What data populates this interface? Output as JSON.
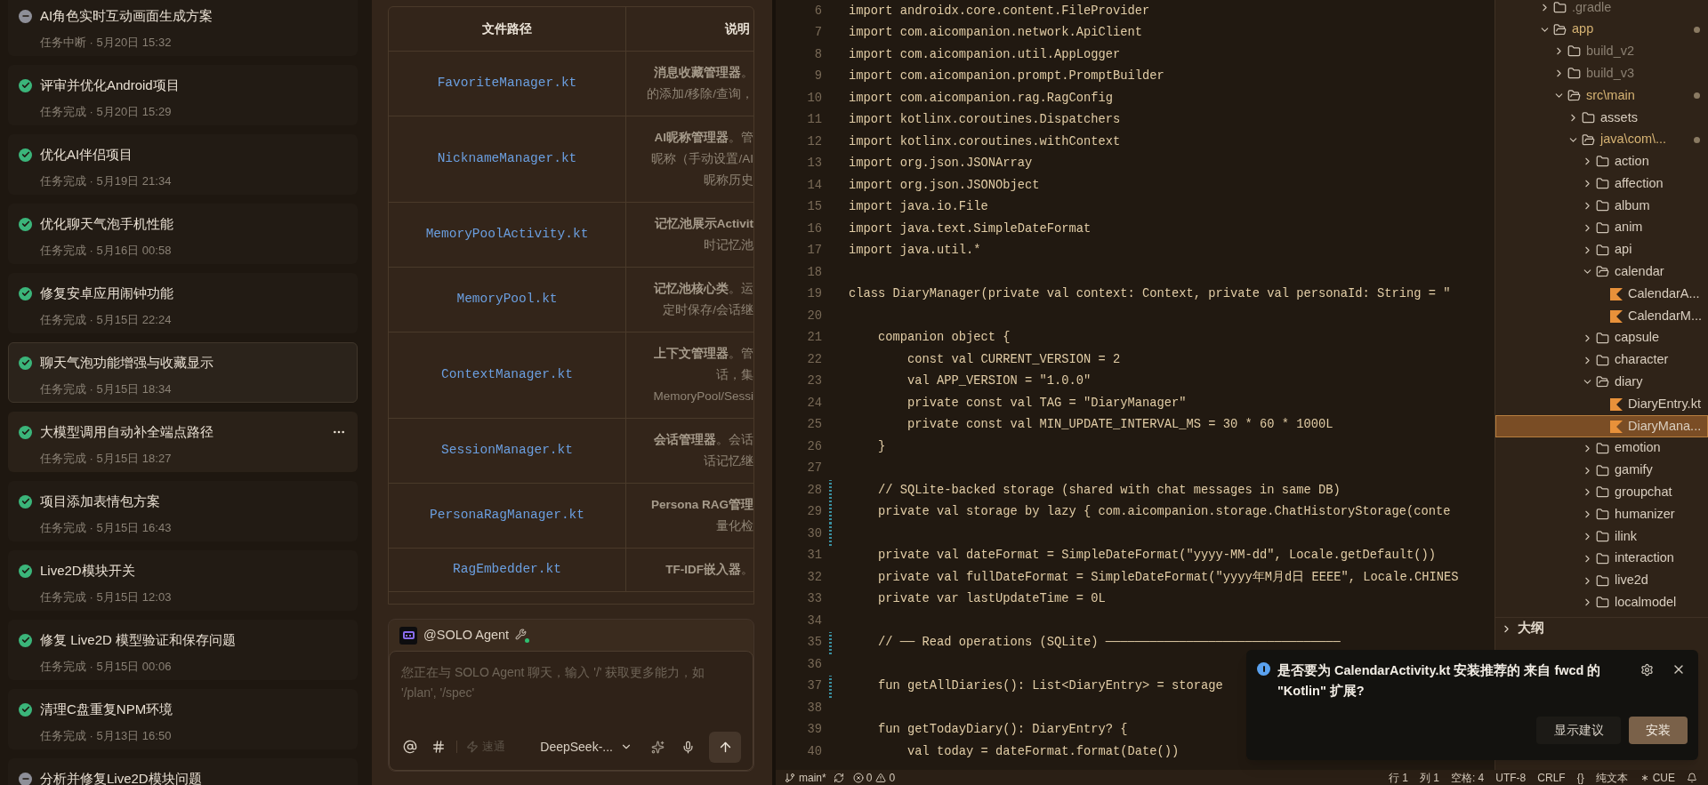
{
  "task_list": {
    "items": [
      {
        "title": "AI角色实时互动画面生成方案",
        "subtitle": "任务中断 · 5月20日 15:32",
        "completed": false,
        "selected": false,
        "hovered": false
      },
      {
        "title": "评审并优化Android项目",
        "subtitle": "任务完成 · 5月20日 15:29",
        "completed": true,
        "selected": false,
        "hovered": false
      },
      {
        "title": "优化AI伴侣项目",
        "subtitle": "任务完成 · 5月19日 21:34",
        "completed": true,
        "selected": false,
        "hovered": false
      },
      {
        "title": "优化聊天气泡手机性能",
        "subtitle": "任务完成 · 5月16日 00:58",
        "completed": true,
        "selected": false,
        "hovered": false
      },
      {
        "title": "修复安卓应用闹钟功能",
        "subtitle": "任务完成 · 5月15日 22:24",
        "completed": true,
        "selected": false,
        "hovered": false
      },
      {
        "title": "聊天气泡功能增强与收藏显示",
        "subtitle": "任务完成 · 5月15日 18:34",
        "completed": true,
        "selected": true,
        "hovered": false
      },
      {
        "title": "大模型调用自动补全端点路径",
        "subtitle": "任务完成 · 5月15日 18:27",
        "completed": true,
        "selected": false,
        "hovered": true
      },
      {
        "title": "项目添加表情包方案",
        "subtitle": "任务完成 · 5月15日 16:43",
        "completed": true,
        "selected": false,
        "hovered": false
      },
      {
        "title": "Live2D模块开关",
        "subtitle": "任务完成 · 5月15日 12:03",
        "completed": true,
        "selected": false,
        "hovered": false
      },
      {
        "title": "修复 Live2D 模型验证和保存问题",
        "subtitle": "任务完成 · 5月15日 00:06",
        "completed": true,
        "selected": false,
        "hovered": false
      },
      {
        "title": "清理C盘重复NPM环境",
        "subtitle": "任务完成 · 5月13日 16:50",
        "completed": true,
        "selected": false,
        "hovered": false
      },
      {
        "title": "分析并修复Live2D模块问题",
        "completed": false,
        "selected": false,
        "hovered": false
      }
    ]
  },
  "doc_table": {
    "columns": [
      "文件路径",
      "说明"
    ],
    "rows": [
      {
        "file": "FavoriteManager.kt",
        "description": [
          "**消息收藏管理器**。",
          "的添加/移除/查询，"
        ]
      },
      {
        "file": "NicknameManager.kt",
        "description": [
          "**AI昵称管理器**。管",
          "昵称（手动设置/AI",
          "昵称历史"
        ]
      },
      {
        "file": "MemoryPoolActivity.kt",
        "description": [
          "**记忆池展示Activit**",
          "时记忆池"
        ]
      },
      {
        "file": "MemoryPool.kt",
        "description": [
          "**记忆池核心类**。运",
          "定时保存/会话继"
        ]
      },
      {
        "file": "ContextManager.kt",
        "description": [
          "**上下文管理器**。管",
          "话，集",
          "MemoryPool/Sessi"
        ]
      },
      {
        "file": "SessionManager.kt",
        "description": [
          "**会话管理器**。会话",
          "话记忆继"
        ]
      },
      {
        "file": "PersonaRagManager.kt",
        "description": [
          "**Persona RAG管理**",
          "量化检"
        ]
      },
      {
        "file": "RagEmbedder.kt",
        "description": [
          "**TF-IDF嵌入器**。"
        ]
      }
    ]
  },
  "chat": {
    "agent": "@SOLO Agent",
    "online": true,
    "placeholder": "您正在与 SOLO Agent 聊天，输入 '/' 获取更多能力，如 '/plan', '/spec'",
    "mode": {
      "label": "速通",
      "disabled": true
    },
    "model": "DeepSeek-..."
  },
  "editor": {
    "lines": [
      {
        "n": "6",
        "text": "import androidx.core.content.FileProvider",
        "changed": false
      },
      {
        "n": "7",
        "text": "import com.aicompanion.network.ApiClient",
        "changed": false
      },
      {
        "n": "8",
        "text": "import com.aicompanion.util.AppLogger",
        "changed": false
      },
      {
        "n": "9",
        "text": "import com.aicompanion.prompt.PromptBuilder",
        "changed": false
      },
      {
        "n": "10",
        "text": "import com.aicompanion.rag.RagConfig",
        "changed": false
      },
      {
        "n": "11",
        "text": "import kotlinx.coroutines.Dispatchers",
        "changed": false
      },
      {
        "n": "12",
        "text": "import kotlinx.coroutines.withContext",
        "changed": false
      },
      {
        "n": "13",
        "text": "import org.json.JSONArray",
        "changed": false
      },
      {
        "n": "14",
        "text": "import org.json.JSONObject",
        "changed": false
      },
      {
        "n": "15",
        "text": "import java.io.File",
        "changed": false
      },
      {
        "n": "16",
        "text": "import java.text.SimpleDateFormat",
        "changed": false
      },
      {
        "n": "17",
        "text": "import java.util.*",
        "changed": false
      },
      {
        "n": "18",
        "changed": false
      },
      {
        "n": "19",
        "text": "class DiaryManager(private val context: Context, private val personaId: String = \"",
        "changed": false
      },
      {
        "n": "20",
        "changed": false
      },
      {
        "n": "21",
        "text": "    companion object {",
        "changed": false
      },
      {
        "n": "22",
        "text": "        const val CURRENT_VERSION = 2",
        "changed": false
      },
      {
        "n": "23",
        "text": "        val APP_VERSION = \"1.0.0\"",
        "changed": false
      },
      {
        "n": "24",
        "text": "        private const val TAG = \"DiaryManager\"",
        "changed": false
      },
      {
        "n": "25",
        "text": "        private const val MIN_UPDATE_INTERVAL_MS = 30 * 60 * 1000L",
        "changed": false
      },
      {
        "n": "26",
        "text": "    }",
        "changed": false
      },
      {
        "n": "27",
        "changed": false
      },
      {
        "n": "28",
        "text": "    // SQLite-backed storage (shared with chat messages in same DB)",
        "changed": true
      },
      {
        "n": "29",
        "text": "    private val storage by lazy { com.aicompanion.storage.ChatHistoryStorage(conte",
        "changed": true
      },
      {
        "n": "30",
        "changed": true
      },
      {
        "n": "31",
        "text": "    private val dateFormat = SimpleDateFormat(\"yyyy-MM-dd\", Locale.getDefault())",
        "changed": false
      },
      {
        "n": "32",
        "text": "    private val fullDateFormat = SimpleDateFormat(\"yyyy年M月d日 EEEE\", Locale.CHINES",
        "changed": false
      },
      {
        "n": "33",
        "text": "    private var lastUpdateTime = 0L",
        "changed": false
      },
      {
        "n": "34",
        "changed": false
      },
      {
        "n": "35",
        "text": "    // ── Read operations (SQLite) ────────────────────────────────",
        "changed": true
      },
      {
        "n": "36",
        "changed": false
      },
      {
        "n": "37",
        "text": "    fun getAllDiaries(): List<DiaryEntry> = storage",
        "changed": true
      },
      {
        "n": "38",
        "changed": false
      },
      {
        "n": "39",
        "text": "    fun getTodayDiary(): DiaryEntry? {",
        "changed": false
      },
      {
        "n": "40",
        "text": "        val today = dateFormat.format(Date())",
        "changed": false
      }
    ]
  },
  "explorer": {
    "tree": [
      {
        "name": ".gradle",
        "kind": "folder",
        "expanded": false,
        "ignored": true,
        "modified": false,
        "selected": false
      },
      {
        "name": "app",
        "kind": "folder",
        "expanded": true,
        "ignored": false,
        "modified": true,
        "selected": false,
        "children": [
          {
            "name": "build_v2",
            "kind": "folder",
            "expanded": false,
            "ignored": true,
            "modified": false,
            "selected": false
          },
          {
            "name": "build_v3",
            "kind": "folder",
            "expanded": false,
            "ignored": true,
            "modified": false,
            "selected": false
          },
          {
            "name": "src\\main",
            "kind": "folder",
            "expanded": true,
            "ignored": false,
            "modified": true,
            "selected": false,
            "children": [
              {
                "name": "assets",
                "kind": "folder",
                "expanded": false,
                "ignored": false,
                "modified": false,
                "selected": false
              },
              {
                "name": "java\\com\\...",
                "kind": "folder",
                "expanded": true,
                "ignored": false,
                "modified": true,
                "selected": false,
                "children": [
                  {
                    "name": "action",
                    "kind": "folder",
                    "expanded": false,
                    "ignored": false,
                    "modified": false,
                    "selected": false
                  },
                  {
                    "name": "affection",
                    "kind": "folder",
                    "expanded": false,
                    "ignored": false,
                    "modified": false,
                    "selected": false
                  },
                  {
                    "name": "album",
                    "kind": "folder",
                    "expanded": false,
                    "ignored": false,
                    "modified": false,
                    "selected": false
                  },
                  {
                    "name": "anim",
                    "kind": "folder",
                    "expanded": false,
                    "ignored": false,
                    "modified": false,
                    "selected": false
                  },
                  {
                    "name": "api",
                    "kind": "folder",
                    "expanded": false,
                    "ignored": false,
                    "modified": false,
                    "selected": false
                  },
                  {
                    "name": "calendar",
                    "kind": "folder",
                    "expanded": true,
                    "ignored": false,
                    "modified": false,
                    "selected": false,
                    "children": [
                      {
                        "name": "CalendarA...",
                        "kind": "file",
                        "ignored": false,
                        "modified": false,
                        "selected": false
                      },
                      {
                        "name": "CalendarM...",
                        "kind": "file",
                        "ignored": false,
                        "modified": false,
                        "selected": false
                      }
                    ]
                  },
                  {
                    "name": "capsule",
                    "kind": "folder",
                    "expanded": false,
                    "ignored": false,
                    "modified": false,
                    "selected": false
                  },
                  {
                    "name": "character",
                    "kind": "folder",
                    "expanded": false,
                    "ignored": false,
                    "modified": false,
                    "selected": false
                  },
                  {
                    "name": "diary",
                    "kind": "folder",
                    "expanded": true,
                    "ignored": false,
                    "modified": false,
                    "selected": false,
                    "children": [
                      {
                        "name": "DiaryEntry.kt",
                        "kind": "file",
                        "ignored": false,
                        "modified": false,
                        "selected": false
                      },
                      {
                        "name": "DiaryMana...",
                        "kind": "file",
                        "ignored": false,
                        "modified": false,
                        "selected": true
                      }
                    ]
                  },
                  {
                    "name": "emotion",
                    "kind": "folder",
                    "expanded": false,
                    "ignored": false,
                    "modified": false,
                    "selected": false
                  },
                  {
                    "name": "gamify",
                    "kind": "folder",
                    "expanded": false,
                    "ignored": false,
                    "modified": false,
                    "selected": false
                  },
                  {
                    "name": "groupchat",
                    "kind": "folder",
                    "expanded": false,
                    "ignored": false,
                    "modified": false,
                    "selected": false
                  },
                  {
                    "name": "humanizer",
                    "kind": "folder",
                    "expanded": false,
                    "ignored": false,
                    "modified": false,
                    "selected": false
                  },
                  {
                    "name": "ilink",
                    "kind": "folder",
                    "expanded": false,
                    "ignored": false,
                    "modified": false,
                    "selected": false
                  },
                  {
                    "name": "interaction",
                    "kind": "folder",
                    "expanded": false,
                    "ignored": false,
                    "modified": false,
                    "selected": false
                  },
                  {
                    "name": "live2d",
                    "kind": "folder",
                    "expanded": false,
                    "ignored": false,
                    "modified": false,
                    "selected": false
                  },
                  {
                    "name": "localmodel",
                    "kind": "folder",
                    "expanded": false,
                    "ignored": false,
                    "modified": false,
                    "selected": false
                  }
                ]
              }
            ]
          }
        ]
      }
    ],
    "sections": [
      {
        "title": "大纲",
        "expanded": false
      }
    ]
  },
  "notification": {
    "message": "是否要为 CalendarActivity.kt 安装推荐的 来自 fwcd 的 \"Kotlin\" 扩展?",
    "buttons": [
      {
        "label": "显示建议",
        "primary": false
      },
      {
        "label": "安装",
        "primary": true
      }
    ]
  },
  "status_bar": {
    "branch": "main*",
    "errors": "0",
    "warnings": "0",
    "items": [
      "行 1",
      "列 1",
      "空格: 4",
      "UTF-8",
      "CRLF",
      "{}",
      "纯文本",
      "CUE"
    ]
  }
}
